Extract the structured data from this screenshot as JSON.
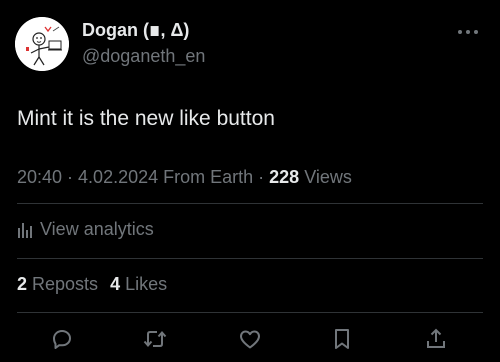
{
  "author": {
    "display_name": "Dogan (∎, Δ)",
    "handle": "@doganeth_en"
  },
  "tweet": {
    "text": "Mint it is the new like button"
  },
  "meta": {
    "time": "20:40",
    "sep1": " · ",
    "date": "4.02.2024",
    "location": " From Earth",
    "sep2": " · ",
    "views_count": "228",
    "views_label": " Views"
  },
  "analytics": {
    "label": "View analytics"
  },
  "stats": {
    "reposts_count": "2",
    "reposts_label": "Reposts",
    "likes_count": "4",
    "likes_label": "Likes"
  },
  "colors": {
    "background": "#000000",
    "text_primary": "#e7e9ea",
    "text_secondary": "#71767b",
    "divider": "#2f3336"
  },
  "icons": {
    "more": "more-horizontal-icon",
    "analytics": "bar-chart-icon",
    "reply": "reply-icon",
    "repost": "repost-icon",
    "like": "heart-icon",
    "bookmark": "bookmark-icon",
    "share": "share-icon"
  }
}
